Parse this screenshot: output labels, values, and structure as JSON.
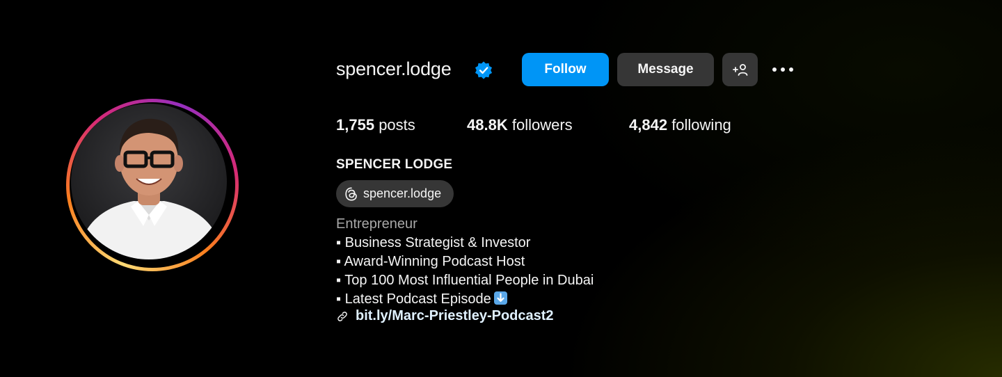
{
  "profile": {
    "username": "spencer.lodge",
    "verified": true,
    "full_name": "SPENCER LODGE",
    "threads_handle": "spencer.lodge"
  },
  "actions": {
    "follow_label": "Follow",
    "message_label": "Message",
    "add_user_icon": "person-add-icon",
    "more_icon": "more-options-icon"
  },
  "stats": {
    "posts_count": "1,755",
    "posts_label": "posts",
    "followers_count": "48.8K",
    "followers_label": "followers",
    "following_count": "4,842",
    "following_label": "following"
  },
  "bio": {
    "category": "Entrepreneur",
    "lines": [
      "▪ Business Strategist & Investor",
      "▪ Award-Winning Podcast Host",
      "▪ Top 100 Most Influential People in Dubai",
      "▪ Latest Podcast Episode"
    ],
    "link": "bit.ly/Marc-Priestley-Podcast2"
  },
  "colors": {
    "accent": "#0095f6",
    "button_secondary": "#363636",
    "background": "#000000",
    "story_ring": [
      "#feda75",
      "#fa7e1e",
      "#d62976",
      "#962fbf"
    ]
  }
}
